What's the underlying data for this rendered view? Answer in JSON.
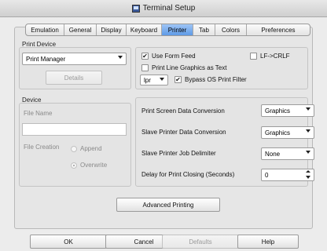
{
  "window": {
    "title": "Terminal Setup"
  },
  "tabs": [
    {
      "label": "Emulation",
      "active": false
    },
    {
      "label": "General",
      "active": false
    },
    {
      "label": "Display",
      "active": false
    },
    {
      "label": "Keyboard",
      "active": false
    },
    {
      "label": "Printer",
      "active": true
    },
    {
      "label": "Tab",
      "active": false
    },
    {
      "label": "Colors",
      "active": false
    },
    {
      "label": "Preferences",
      "active": false
    }
  ],
  "print_device": {
    "heading": "Print Device",
    "select_value": "Print Manager",
    "details_label": "Details"
  },
  "options": {
    "use_form_feed": {
      "label": "Use Form Feed",
      "checked": true
    },
    "lf_crlf": {
      "label": "LF->CRLF",
      "checked": false
    },
    "print_line_graphics": {
      "label": "Print Line Graphics as Text",
      "checked": false
    },
    "lpr_value": "lpr",
    "bypass_os_filter": {
      "label": "Bypass OS Print Filter",
      "checked": true
    }
  },
  "device": {
    "heading": "Device",
    "file_name_label": "File Name",
    "file_name_value": "",
    "file_creation_label": "File Creation",
    "append_label": "Append",
    "overwrite_label": "Overwrite",
    "selected": "Overwrite"
  },
  "conversions": [
    {
      "label": "Print Screen Data Conversion",
      "value": "Graphics"
    },
    {
      "label": "Slave Printer Data Conversion",
      "value": "Graphics"
    },
    {
      "label": "Slave Printer Job Delimiter",
      "value": "None"
    },
    {
      "label": "Delay for Print Closing (Seconds)",
      "value": "0"
    }
  ],
  "advanced_printing_label": "Advanced Printing",
  "footer": {
    "ok": "OK",
    "cancel": "Cancel",
    "defaults": "Defaults",
    "help": "Help"
  },
  "colors": {
    "active_tab": "#5e9ae6",
    "window_bg": "#ececec"
  }
}
